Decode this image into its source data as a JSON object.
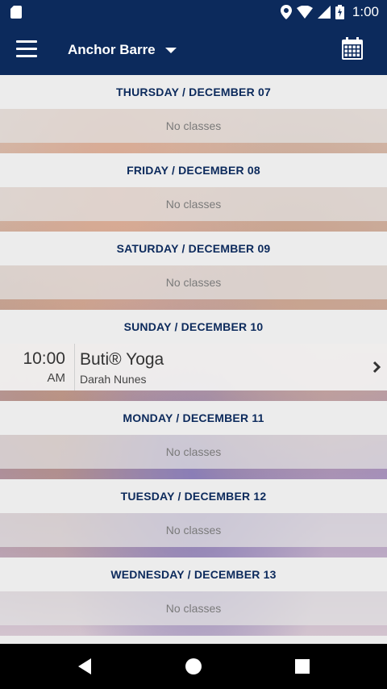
{
  "status_bar": {
    "time": "1:00"
  },
  "app_bar": {
    "studio_name": "Anchor Barre",
    "icons": [
      "menu-icon",
      "dropdown-arrow-icon",
      "calendar-icon"
    ]
  },
  "days": [
    {
      "header": "THURSDAY / DECEMBER 07",
      "empty_text": "No classes"
    },
    {
      "header": "FRIDAY / DECEMBER 08",
      "empty_text": "No classes"
    },
    {
      "header": "SATURDAY / DECEMBER 09",
      "empty_text": "No classes"
    },
    {
      "header": "SUNDAY / DECEMBER 10",
      "classes": [
        {
          "time": "10:00",
          "ampm": "AM",
          "name": "Buti® Yoga",
          "instructor": "Darah Nunes"
        }
      ]
    },
    {
      "header": "MONDAY / DECEMBER 11",
      "empty_text": "No classes"
    },
    {
      "header": "TUESDAY / DECEMBER 12",
      "empty_text": "No classes"
    },
    {
      "header": "WEDNESDAY / DECEMBER 13",
      "empty_text": "No classes"
    }
  ],
  "nav": {
    "icons": [
      "back-icon",
      "home-icon",
      "recents-icon"
    ]
  },
  "colors": {
    "primary": "#0c2a5c",
    "header_bg": "#ececec",
    "muted_text": "#7a7a7a"
  }
}
